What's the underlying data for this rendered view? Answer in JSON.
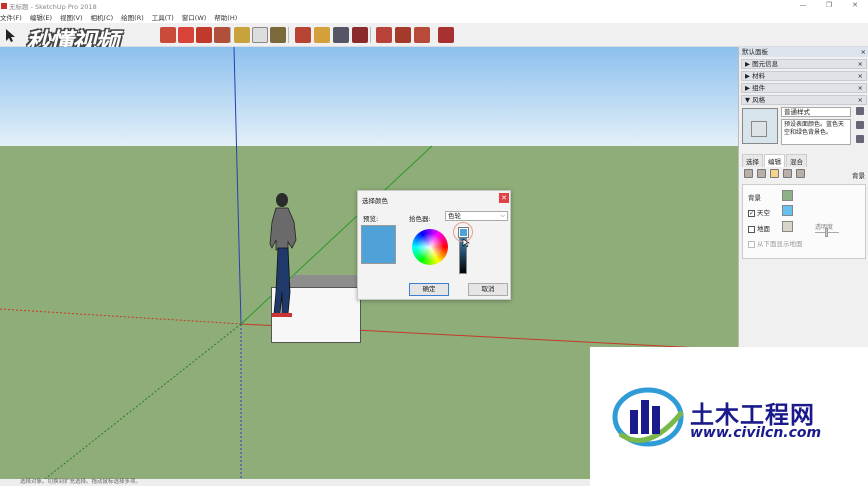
{
  "window": {
    "title": "无标题 - SketchUp Pro 2018",
    "controls": [
      "—",
      "❐",
      "✕"
    ]
  },
  "menu": [
    "文件(F)",
    "编辑(E)",
    "视图(V)",
    "相机(C)",
    "绘图(R)",
    "工具(T)",
    "窗口(W)",
    "帮助(H)"
  ],
  "watermark": "秒懂视频",
  "dialog": {
    "title": "选择颜色",
    "preview_label": "预览:",
    "picker_label": "拾色器:",
    "picker_value": "色轮",
    "ok_label": "确定",
    "cancel_label": "取消",
    "color": "#4ea2d8",
    "close_icon": "close-icon"
  },
  "panel": {
    "title": "默认面板",
    "trays": [
      {
        "label": "▶ 图元信息"
      },
      {
        "label": "▶ 材料"
      },
      {
        "label": "▶ 组件"
      },
      {
        "label": "▼ 风格"
      }
    ],
    "style_name": "普通样式",
    "style_desc": "预设表面颜色。蓝色天空和绿色背景色。",
    "tabs": [
      "选择",
      "编辑",
      "混合"
    ],
    "tab_section": "背景",
    "background": {
      "bg_label": "背景",
      "sky_label": "天空",
      "ground_label": "地面",
      "transparency_label": "透明度",
      "show_below_label": "从下面显示地面",
      "bg_color": "#8fb187",
      "sky_color": "#66c0f0",
      "ground_color": "#d8d6c8"
    }
  },
  "statusbar": "选择对象。切换到扩充选择。拖动鼠标选择多项。",
  "logo": {
    "cn": "土木工程网",
    "url": "www.civilcn.com"
  }
}
